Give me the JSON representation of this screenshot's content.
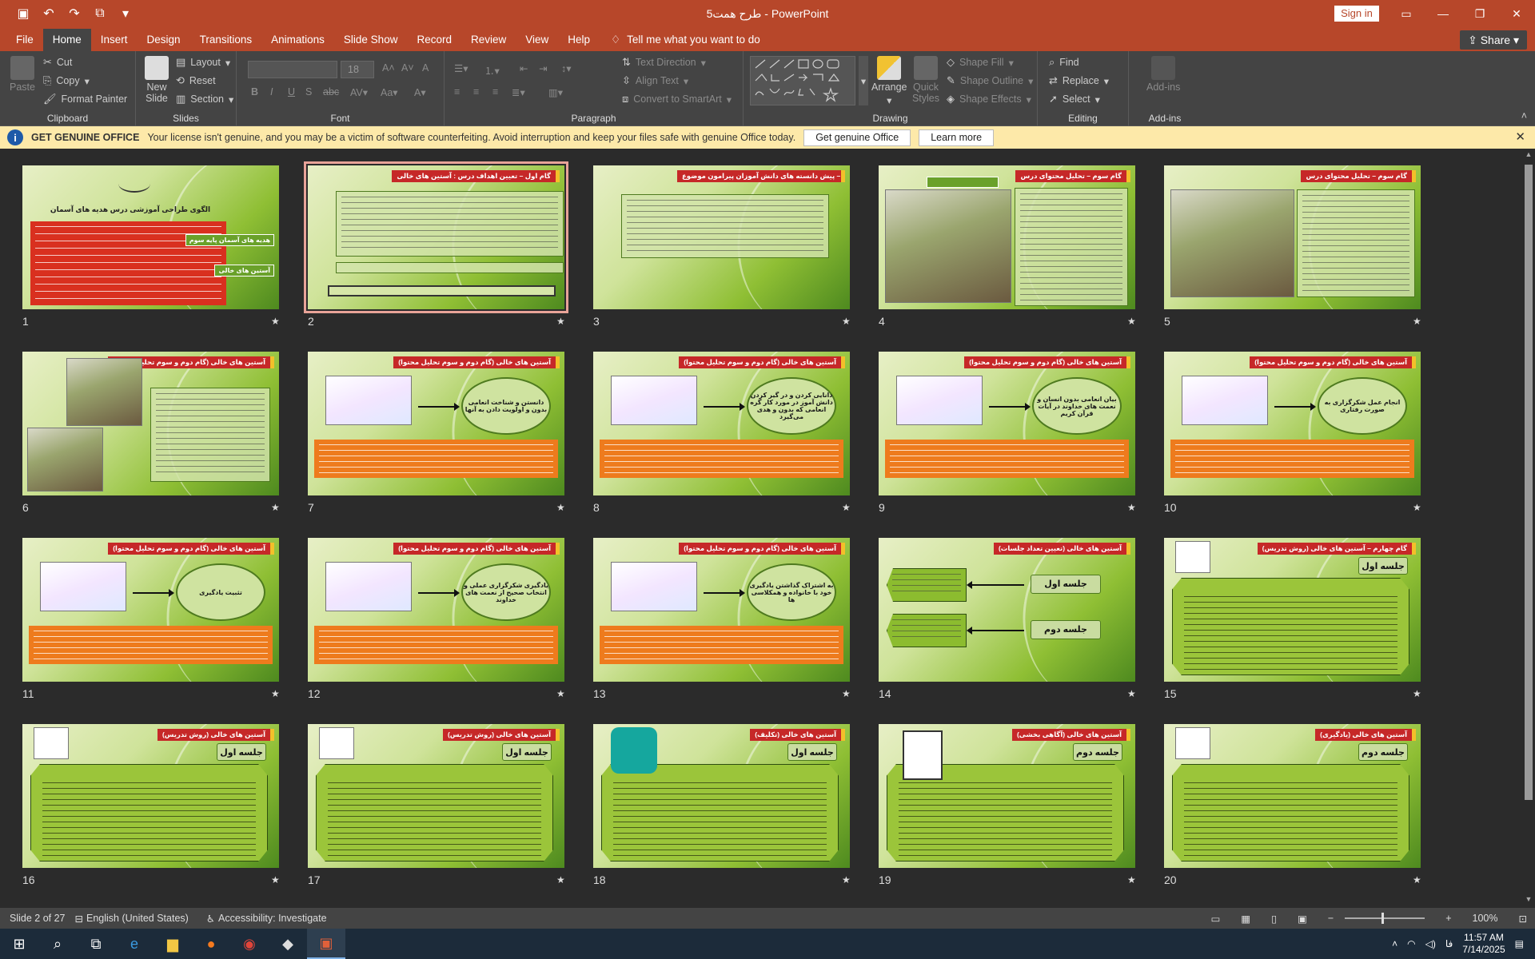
{
  "window": {
    "title": "طرح همت5  -  PowerPoint",
    "sign_in": "Sign in"
  },
  "ribbon_tabs": [
    "File",
    "Home",
    "Insert",
    "Design",
    "Transitions",
    "Animations",
    "Slide Show",
    "Record",
    "Review",
    "View",
    "Help"
  ],
  "tell_me": "Tell me what you want to do",
  "share": "Share",
  "clipboard": {
    "paste": "Paste",
    "cut": "Cut",
    "copy": "Copy",
    "format_painter": "Format Painter",
    "label": "Clipboard"
  },
  "slides_group": {
    "new_slide": "New Slide",
    "layout": "Layout",
    "reset": "Reset",
    "section": "Section",
    "label": "Slides"
  },
  "font_group": {
    "font_size": "18",
    "label": "Font",
    "bold": "B",
    "italic": "I",
    "underline": "U",
    "shadow": "S",
    "strike": "abc"
  },
  "paragraph_group": {
    "text_direction": "Text Direction",
    "align_text": "Align Text",
    "smartart": "Convert to SmartArt",
    "label": "Paragraph"
  },
  "drawing_group": {
    "arrange": "Arrange",
    "quick_styles": "Quick Styles",
    "shape_fill": "Shape Fill",
    "shape_outline": "Shape Outline",
    "shape_effects": "Shape Effects",
    "label": "Drawing"
  },
  "editing_group": {
    "find": "Find",
    "replace": "Replace",
    "select": "Select",
    "label": "Editing"
  },
  "addins_group": {
    "addins": "Add-ins",
    "label": "Add-ins"
  },
  "message_bar": {
    "title": "GET GENUINE OFFICE",
    "text": "Your license isn't genuine, and you may be a victim of software counterfeiting. Avoid interruption and keep your files safe with genuine Office today.",
    "btn_genuine": "Get genuine Office",
    "btn_learn": "Learn more"
  },
  "slides": [
    {
      "num": "1",
      "title": "",
      "kind": "cover"
    },
    {
      "num": "2",
      "title": "گام اول  – تعیین اهداف درس : آستین های خالی",
      "kind": "list"
    },
    {
      "num": "3",
      "title": "گام دوم  – پیش دانسته های دانش آموزان پیرامون موضوع",
      "kind": "list2"
    },
    {
      "num": "4",
      "title": "گام سوم  – تحلیل محتوای درس",
      "kind": "photo-text"
    },
    {
      "num": "5",
      "title": "گام سوم  – تحلیل محتوای درس",
      "kind": "photo-text2"
    },
    {
      "num": "6",
      "title": "آستین های خالی (گام دوم و سوم تحلیل محتوا)",
      "kind": "photos"
    },
    {
      "num": "7",
      "title": "آستین های خالی (گام دوم و سوم تحلیل محتوا)",
      "kind": "arrow"
    },
    {
      "num": "8",
      "title": "آستین های خالی (گام دوم و سوم تحلیل محتوا)",
      "kind": "arrow"
    },
    {
      "num": "9",
      "title": "آستین های خالی (گام دوم و سوم تحلیل محتوا)",
      "kind": "arrow"
    },
    {
      "num": "10",
      "title": "آستین های خالی (گام دوم و سوم تحلیل محتوا)",
      "kind": "arrow"
    },
    {
      "num": "11",
      "title": "آستین های خالی (گام دوم و سوم تحلیل محتوا)",
      "kind": "arrow"
    },
    {
      "num": "12",
      "title": "آستین های خالی (گام دوم و سوم تحلیل محتوا)",
      "kind": "arrow"
    },
    {
      "num": "13",
      "title": "آستین های خالی (گام دوم و سوم تحلیل محتوا)",
      "kind": "arrow"
    },
    {
      "num": "14",
      "title": "آستین های خالی (تعیین تعداد جلسات)",
      "kind": "sessions"
    },
    {
      "num": "15",
      "title": "گام چهارم  – آستین های خالی (روش تدریس)",
      "kind": "octa"
    },
    {
      "num": "16",
      "title": "آستین های خالی (روش تدریس)",
      "kind": "octa"
    },
    {
      "num": "17",
      "title": "آستین های خالی (روش تدریس)",
      "kind": "octa"
    },
    {
      "num": "18",
      "title": "آستین های خالی (تکلیف)",
      "kind": "octa"
    },
    {
      "num": "19",
      "title": "آستین های خالی (آگاهی بخشی)",
      "kind": "octa"
    },
    {
      "num": "20",
      "title": "آستین های خالی (یادگیری)",
      "kind": "octa"
    }
  ],
  "slide_texts": {
    "s1_title": "الگوی طراحی آموزشی درس هدیه های آسمان",
    "s1_tag1": "هدیه های آسمان پایه سوم",
    "s1_tag2": "آستین های خالی",
    "s7_oval": "دانستن و شناخت انعامی بدون و اولویت دادن به آنها",
    "s8_oval": "دانایی کردن و در گیر کردن دانش آموز در مورد کار گره انعامی که بدون و هدی می‌گیرد",
    "s9_oval": "بیان انعامی بدون انسان و نعمت های خداوند در آیات قرآن کریم",
    "s10_oval": "انجام عمل شکرگزاری به صورت رفتاری",
    "s11_oval": "تثبیت یادگیری",
    "s12_oval": "یادگیری شکرگزاری عملی و انتخاب صحیح از نعمت های خداوند",
    "s13_oval": "به اشتراک گذاشتن یادگیری خود با خانواده و همکلاسی ها",
    "s14_p1": "جلسه اول",
    "s14_p2": "جلسه دوم",
    "s15_pill": "جلسه اول",
    "s16_pill": "جلسه اول",
    "s17_pill": "جلسه اول",
    "s18_pill": "جلسه اول",
    "s19_pill": "جلسه دوم",
    "s20_pill": "جلسه دوم"
  },
  "status": {
    "slide_info": "Slide 2 of 27",
    "language": "English (United States)",
    "accessibility": "Accessibility: Investigate",
    "zoom": "100%"
  },
  "tray": {
    "lang": "فا",
    "time": "11:57 AM",
    "date": "7/14/2025"
  }
}
